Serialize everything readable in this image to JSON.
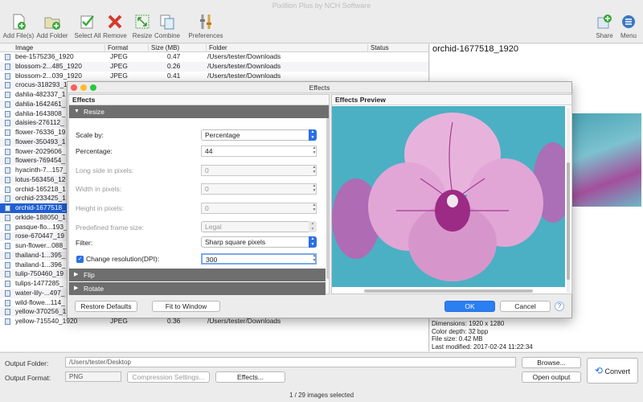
{
  "window": {
    "title": "Pixillion Plus by NCH Software"
  },
  "toolbar": {
    "add_files": "Add File(s)",
    "add_folder": "Add Folder",
    "select_all": "Select All",
    "remove": "Remove",
    "resize": "Resize",
    "combine": "Combine",
    "preferences": "Preferences",
    "share": "Share",
    "menu": "Menu"
  },
  "file_list": {
    "columns": {
      "image": "Image",
      "format": "Format",
      "size": "Size (MB)",
      "folder": "Folder",
      "status": "Status"
    },
    "rows": [
      {
        "name": "bee-1575236_1920",
        "format": "JPEG",
        "size": "0.47",
        "folder": "/Users/tester/Downloads"
      },
      {
        "name": "blossom-2...485_1920",
        "format": "JPEG",
        "size": "0.26",
        "folder": "/Users/tester/Downloads"
      },
      {
        "name": "blossom-2...039_1920",
        "format": "JPEG",
        "size": "0.41",
        "folder": "/Users/tester/Downloads"
      },
      {
        "name": "crocus-318293_1",
        "format": "",
        "size": "",
        "folder": ""
      },
      {
        "name": "dahlia-482337_1",
        "format": "",
        "size": "",
        "folder": ""
      },
      {
        "name": "dahlia-1642461_",
        "format": "",
        "size": "",
        "folder": ""
      },
      {
        "name": "dahlia-1643808_",
        "format": "",
        "size": "",
        "folder": ""
      },
      {
        "name": "daisies-276112_",
        "format": "",
        "size": "",
        "folder": ""
      },
      {
        "name": "flower-76336_19",
        "format": "",
        "size": "",
        "folder": ""
      },
      {
        "name": "flower-350493_1",
        "format": "",
        "size": "",
        "folder": ""
      },
      {
        "name": "flower-2029606_",
        "format": "",
        "size": "",
        "folder": ""
      },
      {
        "name": "flowers-769454_",
        "format": "",
        "size": "",
        "folder": ""
      },
      {
        "name": "hyacinth-7...157_",
        "format": "",
        "size": "",
        "folder": ""
      },
      {
        "name": "lotus-563456_12",
        "format": "",
        "size": "",
        "folder": ""
      },
      {
        "name": "orchid-165218_1",
        "format": "",
        "size": "",
        "folder": ""
      },
      {
        "name": "orchid-233425_1",
        "format": "",
        "size": "",
        "folder": ""
      },
      {
        "name": "orchid-1677518_",
        "format": "",
        "size": "",
        "folder": ""
      },
      {
        "name": "orkide-188050_1",
        "format": "",
        "size": "",
        "folder": ""
      },
      {
        "name": "pasque-flo...193_",
        "format": "",
        "size": "",
        "folder": ""
      },
      {
        "name": "rose-670447_19",
        "format": "",
        "size": "",
        "folder": ""
      },
      {
        "name": "sun-flower...088_",
        "format": "",
        "size": "",
        "folder": ""
      },
      {
        "name": "thailand-1...395_",
        "format": "",
        "size": "",
        "folder": ""
      },
      {
        "name": "thailand-1...396_",
        "format": "",
        "size": "",
        "folder": ""
      },
      {
        "name": "tulip-750460_19",
        "format": "",
        "size": "",
        "folder": ""
      },
      {
        "name": "tulips-1477285_",
        "format": "",
        "size": "",
        "folder": ""
      },
      {
        "name": "water-lily-...497_",
        "format": "",
        "size": "",
        "folder": ""
      },
      {
        "name": "wild-flowe...114_",
        "format": "",
        "size": "",
        "folder": ""
      },
      {
        "name": "yellow-370256_1",
        "format": "",
        "size": "",
        "folder": ""
      },
      {
        "name": "yellow-715540_1920",
        "format": "JPEG",
        "size": "0.36",
        "folder": "/Users/tester/Downloads"
      }
    ],
    "selected_index": 16
  },
  "preview": {
    "title": "orchid-1677518_1920",
    "dimensions": "Dimensions: 1920 x 1280",
    "color_depth": "Color depth: 32 bpp",
    "file_size": "File size: 0.42 MB",
    "last_modified": "Last modified: 2017-02-24 11:22:34"
  },
  "output": {
    "folder_label": "Output Folder:",
    "folder_value": "/Users/tester/Desktop",
    "browse": "Browse...",
    "format_label": "Output Format:",
    "format_value": "PNG",
    "compression": "Compression Settings...",
    "effects": "Effects...",
    "open_output": "Open output",
    "convert": "Convert"
  },
  "status": {
    "text": "1 / 29 images selected"
  },
  "dialog": {
    "title": "Effects",
    "effects_header": "Effects",
    "preview_header": "Effects Preview",
    "section_resize": "Resize",
    "section_flip": "Flip",
    "section_rotate": "Rotate",
    "scale_by_label": "Scale by:",
    "scale_by_value": "Percentage",
    "percentage_label": "Percentage:",
    "percentage_value": "44",
    "long_side_label": "Long side in pixels:",
    "long_side_value": "0",
    "width_label": "Width in pixels:",
    "width_value": "0",
    "height_label": "Height in pixels:",
    "height_value": "0",
    "frame_label": "Predefined frame size:",
    "frame_value": "Legal",
    "filter_label": "Filter:",
    "filter_value": "Sharp square pixels",
    "change_res_label": "Change resolution(DPI):",
    "change_res_value": "300",
    "restore": "Restore Defaults",
    "fit": "Fit to Window",
    "ok": "OK",
    "cancel": "Cancel",
    "help": "?"
  },
  "colors": {
    "accent": "#2b6fe3",
    "selection": "#1f5fd1",
    "section": "#6e6e6e"
  }
}
